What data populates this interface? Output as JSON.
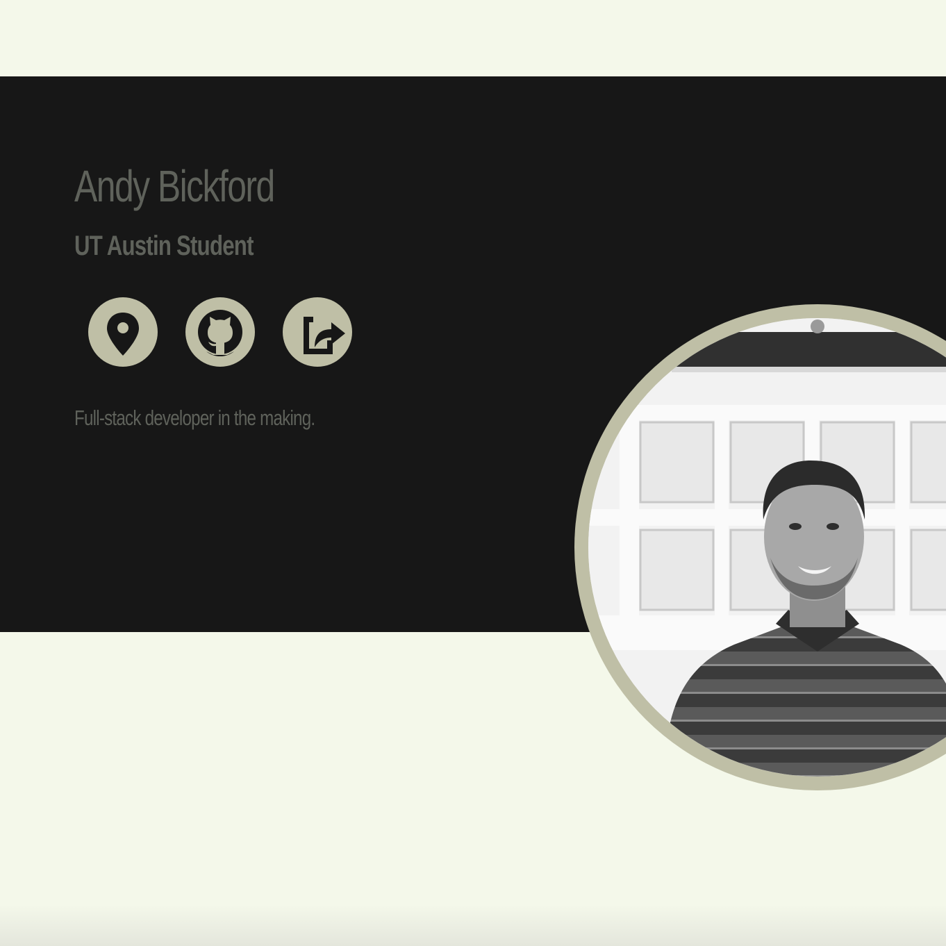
{
  "profile": {
    "name": "Andy Bickford",
    "subtitle": "UT Austin Student",
    "tagline": "Full-stack developer in the making."
  },
  "social": [
    {
      "icon": "map-marker-icon"
    },
    {
      "icon": "github-icon"
    },
    {
      "icon": "share-icon"
    }
  ],
  "colors": {
    "background": "#f4f8ea",
    "hero": "#171717",
    "accent": "#bfbfa6",
    "text": "#5f625b"
  }
}
